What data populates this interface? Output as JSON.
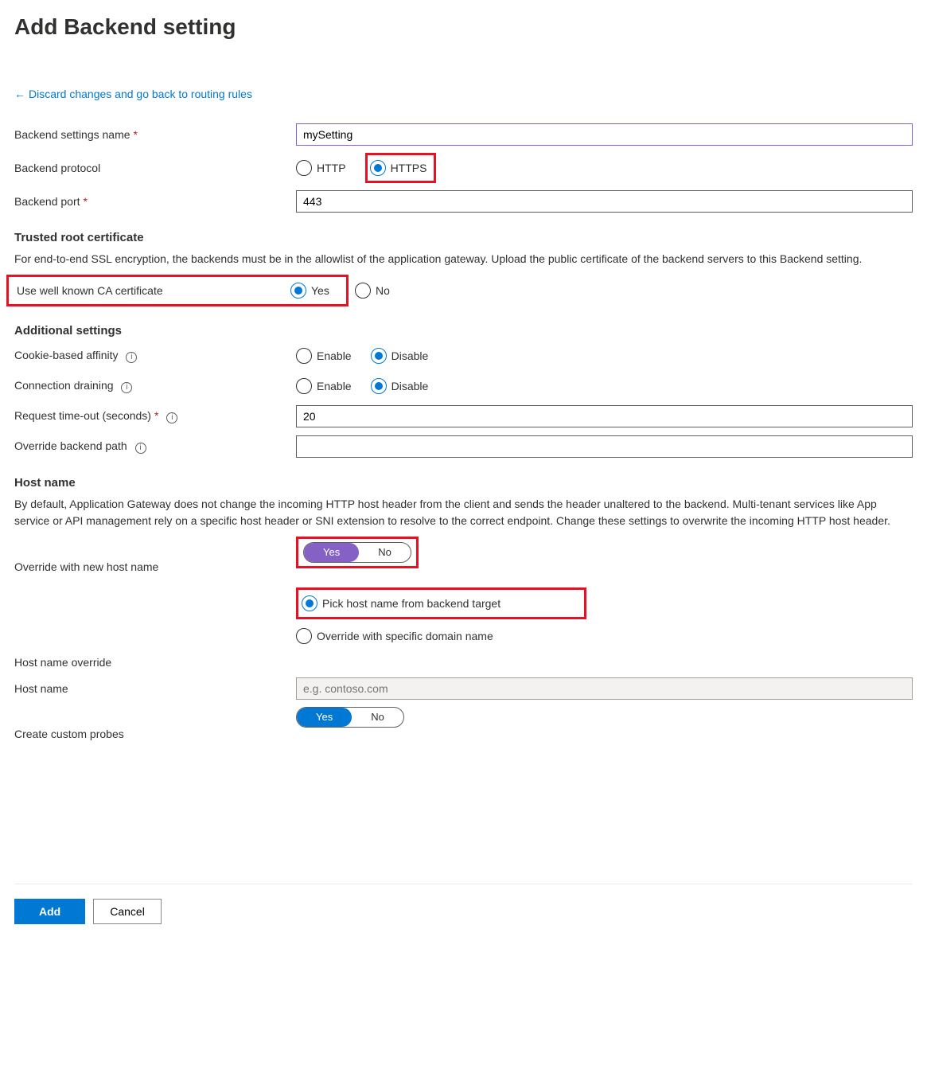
{
  "title": "Add Backend setting",
  "back_link": "Discard changes and go back to routing rules",
  "labels": {
    "settings_name": "Backend settings name",
    "protocol": "Backend protocol",
    "port": "Backend port",
    "trusted_head": "Trusted root certificate",
    "trusted_text": "For end-to-end SSL encryption, the backends must be in the allowlist of the application gateway. Upload the public certificate of the backend servers to this Backend setting.",
    "well_known_ca": "Use well known CA certificate",
    "additional_head": "Additional settings",
    "cookie_affinity": "Cookie-based affinity",
    "connection_draining": "Connection draining",
    "request_timeout": "Request time-out (seconds)",
    "override_backend_path": "Override backend path",
    "host_name_head": "Host name",
    "host_name_text": "By default, Application Gateway does not change the incoming HTTP host header from the client and sends the header unaltered to the backend. Multi-tenant services like App service or API management rely on a specific host header or SNI extension to resolve to the correct endpoint. Change these settings to overwrite the incoming HTTP host header.",
    "override_new_host": "Override with new host name",
    "host_name_override": "Host name override",
    "host_name": "Host name",
    "create_custom_probes": "Create custom probes"
  },
  "values": {
    "settings_name": "mySetting",
    "port": "443",
    "request_timeout": "20",
    "override_backend_path": "",
    "host_name_placeholder": "e.g. contoso.com"
  },
  "options": {
    "http": "HTTP",
    "https": "HTTPS",
    "yes": "Yes",
    "no": "No",
    "enable": "Enable",
    "disable": "Disable",
    "pick_host": "Pick host name from backend target",
    "override_specific": "Override with specific domain name"
  },
  "buttons": {
    "add": "Add",
    "cancel": "Cancel"
  }
}
